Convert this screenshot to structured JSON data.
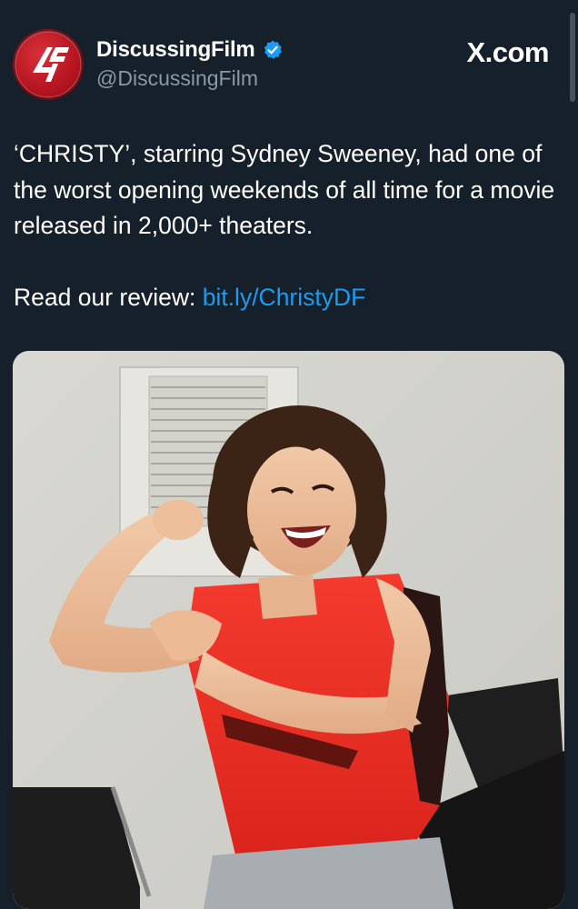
{
  "author": {
    "display_name": "DiscussingFilm",
    "handle": "@DiscussingFilm",
    "verified": true,
    "avatar_logo_text": "DF"
  },
  "source": {
    "label": "X.com"
  },
  "tweet": {
    "text": "‘CHRISTY’, starring Sydney Sweeney, had one of the worst opening weekends of all time for a movie released in 2,000+ theaters.",
    "review_prefix": "Read our review:",
    "review_link": "bit.ly/ChristyDF"
  },
  "media": {
    "alt": "Photo of a smiling woman with curly dark hair in a red sleeveless shirt flexing her arm"
  },
  "colors": {
    "background": "#15202b",
    "text": "#ffffff",
    "secondary_text": "#8b98a5",
    "link": "#1d9bf0",
    "avatar_red": "#c4161f",
    "verified_blue": "#1d9bf0"
  }
}
